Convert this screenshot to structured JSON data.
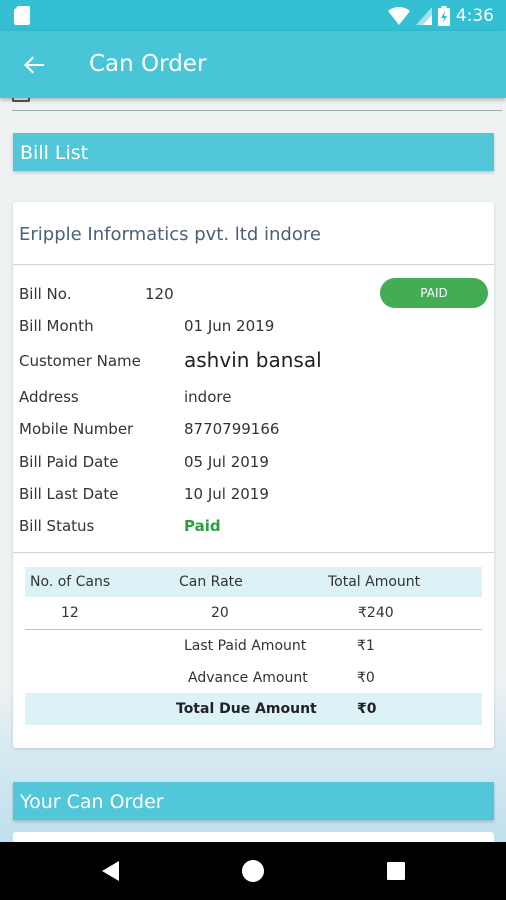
{
  "status_bar": {
    "time": "4:36"
  },
  "app_bar": {
    "title": "Can Order"
  },
  "bill_list": {
    "heading": "Bill List",
    "company": "Eripple Informatics pvt.  ltd indore",
    "status_badge": "PAID",
    "fields": [
      {
        "label": "Bill No.",
        "value": "120"
      },
      {
        "label": "Bill Month",
        "value": "01 Jun 2019"
      },
      {
        "label": "Customer Name",
        "value": "ashvin bansal"
      },
      {
        "label": "Address",
        "value": "indore"
      },
      {
        "label": "Mobile Number",
        "value": "8770799166"
      },
      {
        "label": "Bill Paid Date",
        "value": "05 Jul 2019"
      },
      {
        "label": "Bill Last Date",
        "value": "10 Jul 2019"
      },
      {
        "label": "Bill Status",
        "value": "Paid"
      }
    ],
    "table": {
      "headers": [
        "No. of Cans",
        "Can Rate",
        "Total Amount"
      ],
      "row": [
        "12",
        "20",
        "₹240"
      ],
      "summary": [
        {
          "label": "Last Paid Amount",
          "value": "₹1"
        },
        {
          "label": "Advance Amount",
          "value": "₹0"
        }
      ],
      "total": {
        "label": "Total Due Amount",
        "value": "₹0"
      }
    }
  },
  "your_can_order": {
    "heading": "Your Can Order"
  },
  "colors": {
    "accent": "#48c6d8",
    "paid": "#43ad55",
    "table_bg": "#dcf2f7"
  }
}
